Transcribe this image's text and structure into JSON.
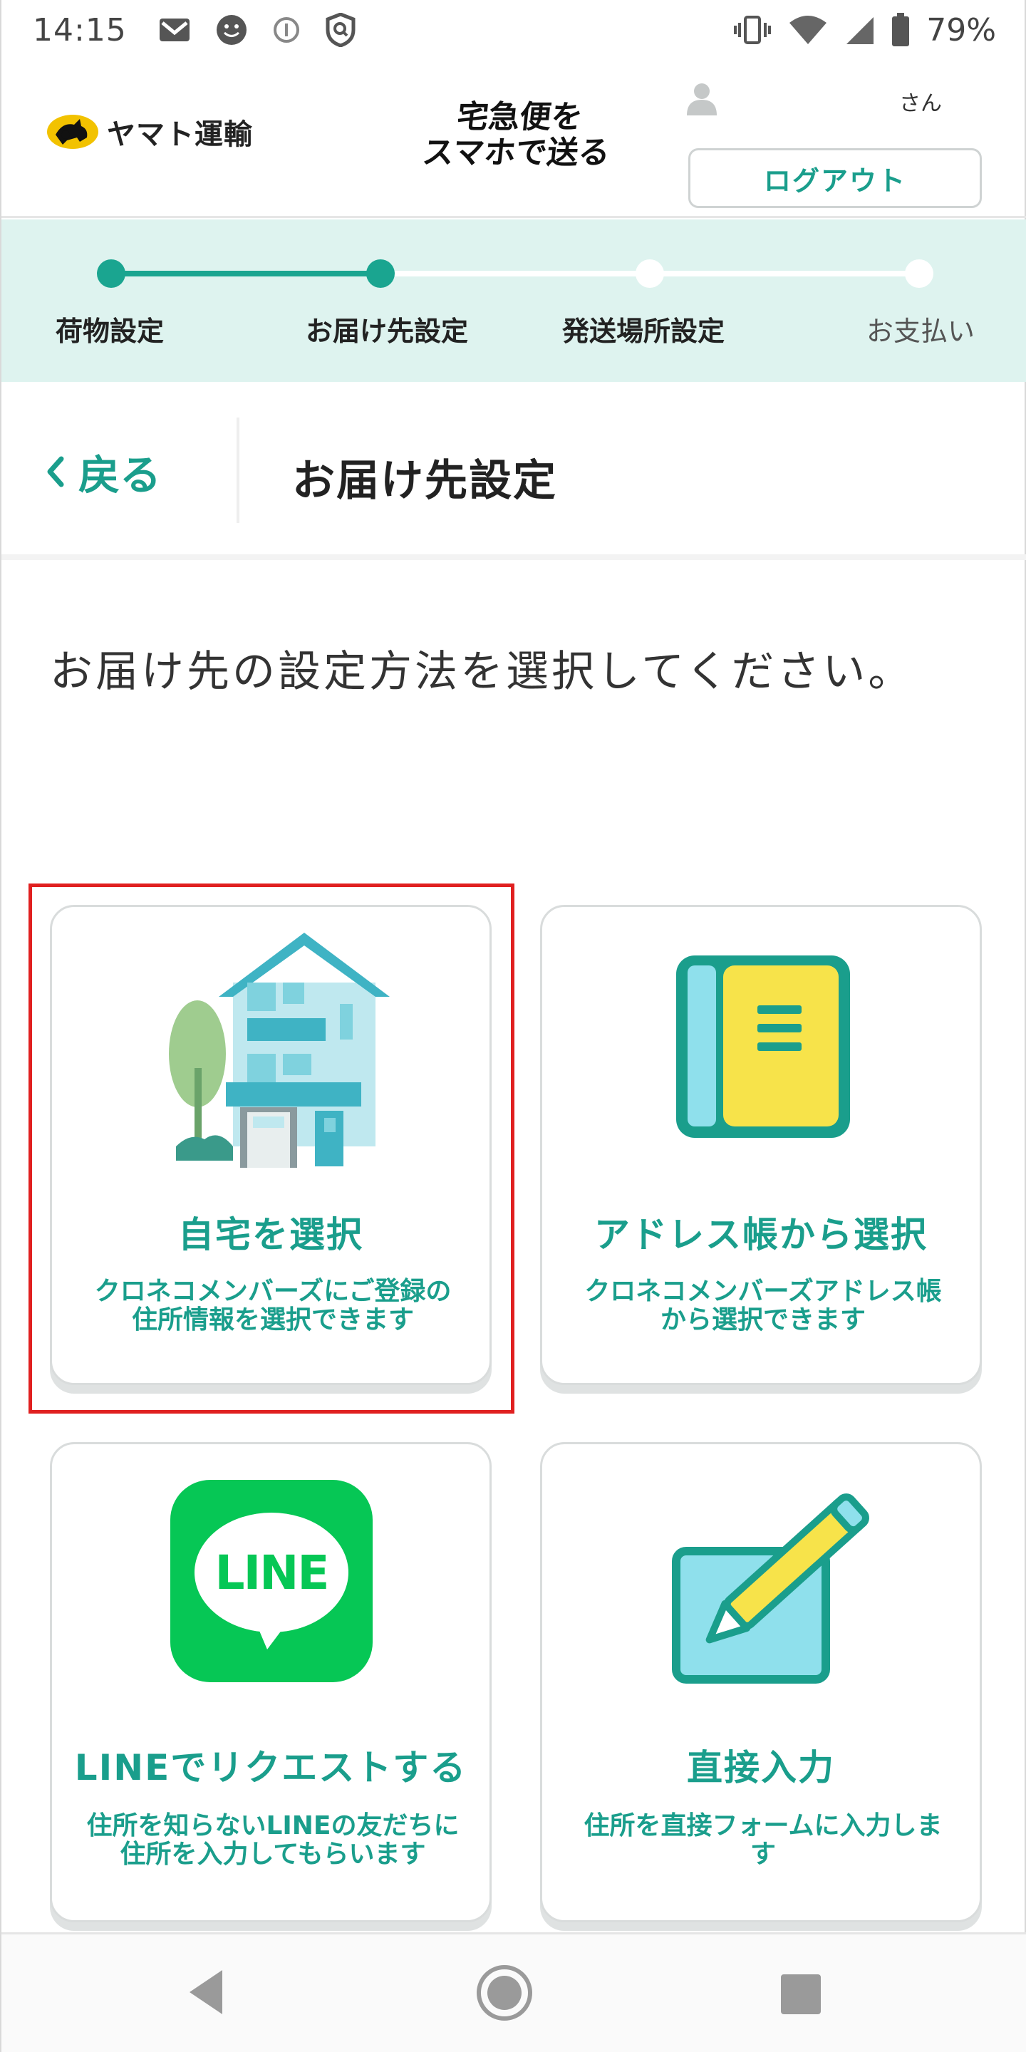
{
  "status_bar": {
    "time": "14:15",
    "battery": "79%"
  },
  "header": {
    "logo_text": "ヤマト運輸",
    "service_title_line1": "宅急便を",
    "service_title_line2": "スマホで送る",
    "user_suffix": "さん",
    "logout_label": "ログアウト"
  },
  "progress": {
    "steps": [
      {
        "label": "荷物設定",
        "state": "done"
      },
      {
        "label": "お届け先設定",
        "state": "current"
      },
      {
        "label": "発送場所設定",
        "state": "pending"
      },
      {
        "label": "お支払い",
        "state": "pending"
      }
    ]
  },
  "nav": {
    "back_label": "戻る",
    "page_title": "お届け先設定"
  },
  "instruction": "お届け先の設定方法を選択してください。",
  "options": [
    {
      "title": "自宅を選択",
      "desc_line1": "クロネコメンバーズにご登録の",
      "desc_line2": "住所情報を選択できます",
      "icon": "house-icon",
      "highlighted": true
    },
    {
      "title": "アドレス帳から選択",
      "desc_line1": "クロネコメンバーズアドレス帳",
      "desc_line2": "から選択できます",
      "icon": "address-book-icon"
    },
    {
      "title": "LINEでリクエストする",
      "desc_line1": "住所を知らないLINEの友だちに",
      "desc_line2": "住所を入力してもらいます",
      "icon": "line-icon",
      "icon_text": "LINE"
    },
    {
      "title": "直接入力",
      "desc_line1": "住所を直接フォームに入力しま",
      "desc_line2": "す",
      "icon": "pencil-form-icon"
    }
  ],
  "colors": {
    "accent": "#1a9e8c",
    "progress_bg": "#def3ef",
    "line_green": "#06c755",
    "highlight": "#e02020"
  }
}
